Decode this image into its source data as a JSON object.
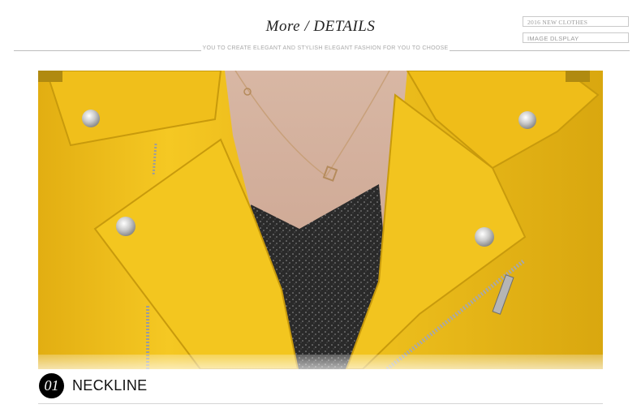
{
  "header": {
    "title_part1": "More",
    "title_part2": "DETAILS",
    "subtitle": "YOU TO CREATE ELEGANT AND STYLISH ELEGANT FASHION FOR YOU TO CHOOSE"
  },
  "tags": {
    "tag1": "2016 NEW CLOTHES",
    "tag2": "IMAGE DLSPLAY"
  },
  "section": {
    "number": "01",
    "label": "NECKLINE"
  },
  "colors": {
    "jacket": "#f2c21d",
    "accent_text": "#222222",
    "badge_bg": "#000000"
  }
}
